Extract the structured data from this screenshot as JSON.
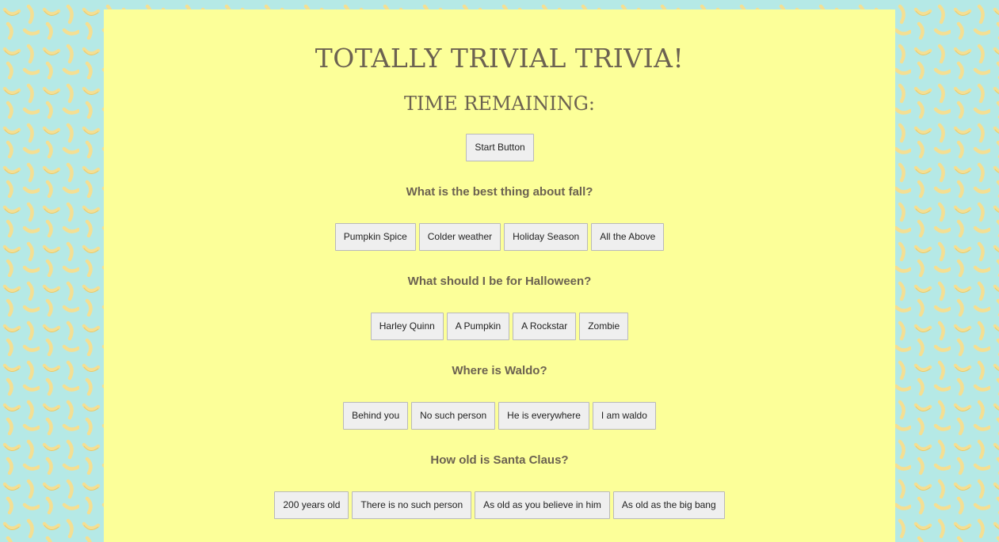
{
  "page": {
    "title": "TOTALLY TRIVIAL TRIVIA!",
    "timer_label": "TIME REMAINING:",
    "start_label": "Start Button"
  },
  "colors": {
    "background": "#b5e9e6",
    "panel": "#fcff99",
    "text": "#6c6251",
    "button_bg": "#efefef",
    "button_border": "#b9b9b9",
    "banana": "#f4df93"
  },
  "background_pattern": "banana-icons",
  "questions": [
    {
      "text": "What is the best thing about fall?",
      "answers": [
        "Pumpkin Spice",
        "Colder weather",
        "Holiday Season",
        "All the Above"
      ]
    },
    {
      "text": "What should I be for Halloween?",
      "answers": [
        "Harley Quinn",
        "A Pumpkin",
        "A Rockstar",
        "Zombie"
      ]
    },
    {
      "text": "Where is Waldo?",
      "answers": [
        "Behind you",
        "No such person",
        "He is everywhere",
        "I am waldo"
      ]
    },
    {
      "text": "How old is Santa Claus?",
      "answers": [
        "200 years old",
        "There is no such person",
        "As old as you believe in him",
        "As old as the big bang"
      ]
    }
  ]
}
